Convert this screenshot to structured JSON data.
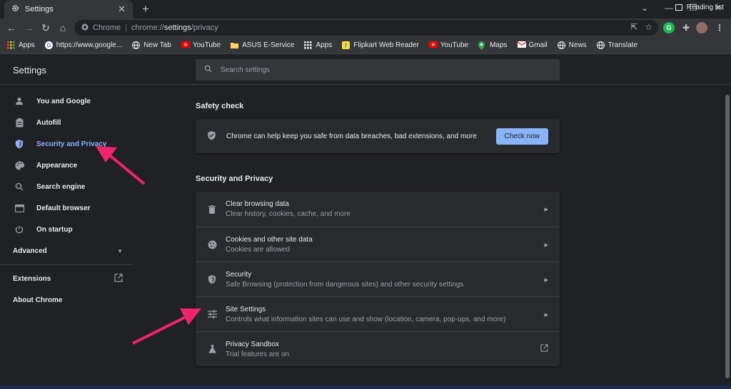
{
  "tab": {
    "title": "Settings",
    "close": "✕"
  },
  "newtab": "+",
  "window_controls": [
    "⌄",
    "—",
    "❐",
    "✕"
  ],
  "omnibox": {
    "site": "Chrome",
    "url_prefix": "chrome://",
    "url_host": "settings",
    "url_path": "/privacy"
  },
  "bookmarks": [
    {
      "label": "Apps",
      "icon": "apps-grid-icon",
      "color": "#ea4335"
    },
    {
      "label": "https://www.google...",
      "icon": "google-icon",
      "color": "#ffffff"
    },
    {
      "label": "New Tab",
      "icon": "globe-icon",
      "color": "#e8eaed"
    },
    {
      "label": "YouTube",
      "icon": "youtube-icon",
      "color": "#ff0000"
    },
    {
      "label": "ASUS E-Service",
      "icon": "folder-icon",
      "color": "#fdd663"
    },
    {
      "label": "Apps",
      "icon": "apps-grid-icon",
      "color": "#e8eaed"
    },
    {
      "label": "Flipkart Web Reader",
      "icon": "flipkart-icon",
      "color": "#f7e12f"
    },
    {
      "label": "YouTube",
      "icon": "youtube-icon",
      "color": "#ff0000"
    },
    {
      "label": "Maps",
      "icon": "maps-icon",
      "color": "#34a853"
    },
    {
      "label": "Gmail",
      "icon": "gmail-icon",
      "color": "#ea4335"
    },
    {
      "label": "News",
      "icon": "globe-icon",
      "color": "#e8eaed"
    },
    {
      "label": "Translate",
      "icon": "globe-icon",
      "color": "#e8eaed"
    }
  ],
  "reading_list": "Reading list",
  "settings": {
    "title": "Settings",
    "search_placeholder": "Search settings",
    "sidebar": {
      "items": [
        {
          "label": "You and Google",
          "icon": "person-icon"
        },
        {
          "label": "Autofill",
          "icon": "clipboard-icon"
        },
        {
          "label": "Security and Privacy",
          "icon": "shield-icon",
          "active": true
        },
        {
          "label": "Appearance",
          "icon": "palette-icon"
        },
        {
          "label": "Search engine",
          "icon": "search-icon"
        },
        {
          "label": "Default browser",
          "icon": "browser-icon"
        },
        {
          "label": "On startup",
          "icon": "power-icon"
        }
      ],
      "advanced": "Advanced",
      "extensions": "Extensions",
      "about": "About Chrome"
    },
    "safety_check": {
      "title": "Safety check",
      "text": "Chrome can help keep you safe from data breaches, bad extensions, and more",
      "button": "Check now"
    },
    "privacy": {
      "title": "Security and Privacy",
      "rows": [
        {
          "title": "Clear browsing data",
          "subtitle": "Clear history, cookies, cache, and more",
          "icon": "trash-icon"
        },
        {
          "title": "Cookies and other site data",
          "subtitle": "Cookies are allowed",
          "icon": "cookie-icon"
        },
        {
          "title": "Security",
          "subtitle": "Safe Browsing (protection from dangerous sites) and other security settings",
          "icon": "shield-icon"
        },
        {
          "title": "Site Settings",
          "subtitle": "Controls what information sites can use and show (location, camera, pop-ups, and more)",
          "icon": "sliders-icon"
        },
        {
          "title": "Privacy Sandbox",
          "subtitle": "Trial features are on",
          "icon": "flask-icon"
        }
      ]
    }
  },
  "colors": {
    "accent": "#8ab4f8",
    "annotation_arrow": "#f0246b"
  }
}
